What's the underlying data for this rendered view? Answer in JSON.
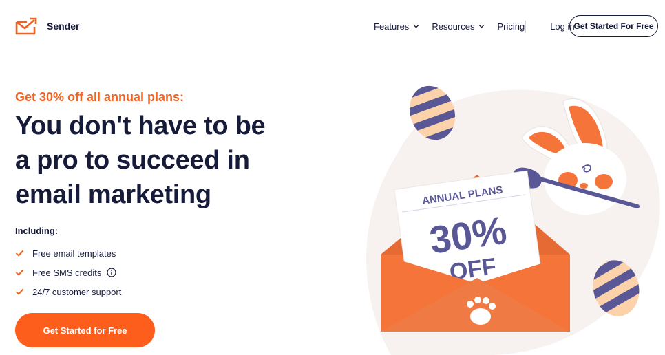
{
  "header": {
    "brand": "Sender",
    "nav": [
      {
        "label": "Features",
        "dropdown": true
      },
      {
        "label": "Resources",
        "dropdown": true
      },
      {
        "label": "Pricing",
        "dropdown": false
      }
    ],
    "login": "Log in",
    "cta": "Get Started For Free"
  },
  "hero": {
    "promo": "Get 30% off all annual plans:",
    "headline": [
      "You don't have to be",
      "a pro to succeed in",
      "email marketing"
    ],
    "including_label": "Including:",
    "features": [
      "Free email templates",
      "Free SMS credits",
      "24/7 customer support"
    ],
    "cta": "Get Started for Free"
  },
  "illustration": {
    "card_title": "ANNUAL PLANS",
    "card_percent": "30%",
    "card_off": "OFF"
  },
  "colors": {
    "accent": "#f4621f",
    "button": "#fd5e1c",
    "navy": "#171b3a",
    "purple": "#5a5796",
    "peach": "#fbd2aa",
    "envelope": "#f5743a"
  },
  "icons": [
    "sender-logo-icon",
    "chevron-down-icon",
    "check-icon",
    "info-icon"
  ]
}
